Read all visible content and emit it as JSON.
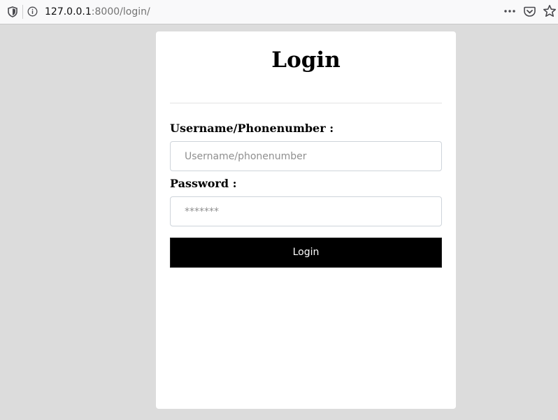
{
  "browser": {
    "url_host": "127.0.0.1",
    "url_rest": ":8000/login/",
    "icons": [
      "shield-icon",
      "info-icon",
      "more-icon",
      "pocket-icon",
      "star-icon"
    ]
  },
  "login": {
    "title": "Login",
    "username_label": "Username/Phonenumber :",
    "username_placeholder": "Username/phonenumber",
    "password_label": "Password :",
    "password_placeholder": "*******",
    "submit_label": "Login"
  },
  "colors": {
    "page_background": "#dcdcdc",
    "card_background": "#ffffff",
    "button_background": "#000000",
    "button_text": "#ffffff"
  }
}
